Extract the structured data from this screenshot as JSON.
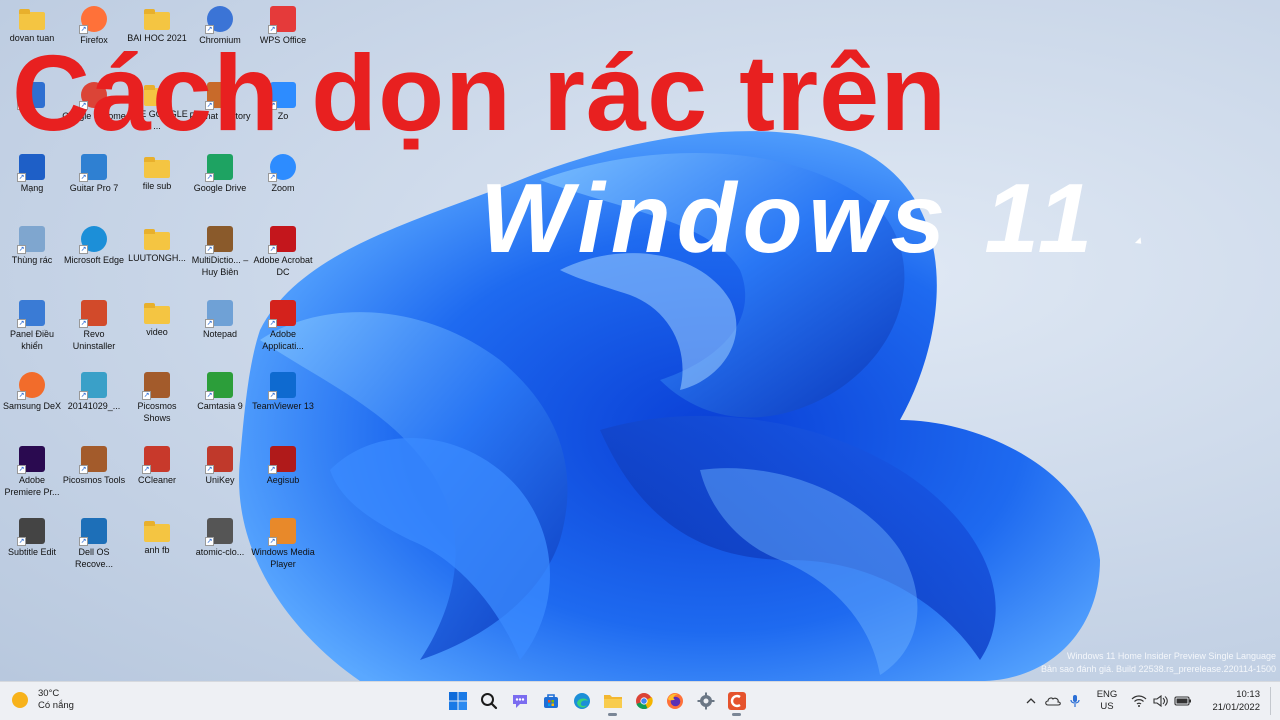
{
  "desktop": {
    "icons": [
      {
        "label": "dovan tuan",
        "icon": "folder-icon"
      },
      {
        "label": "Firefox",
        "icon": "firefox-icon"
      },
      {
        "label": "BAI HOC 2021",
        "icon": "folder-icon"
      },
      {
        "label": "Chromium",
        "icon": "chromium-icon"
      },
      {
        "label": "WPS Office",
        "icon": "wps-office-icon"
      },
      {
        "label": "PC",
        "icon": "pc-icon"
      },
      {
        "label": "Google Chrome",
        "icon": "chrome-icon"
      },
      {
        "label": "A SE GOOGLE ...",
        "icon": "folder-icon"
      },
      {
        "label": "Format Factory",
        "icon": "format-factory-icon"
      },
      {
        "label": "Zo",
        "icon": "zoom-app-icon"
      },
      {
        "label": "Mạng",
        "icon": "network-icon"
      },
      {
        "label": "Guitar Pro 7",
        "icon": "guitar-pro-icon"
      },
      {
        "label": "file sub",
        "icon": "folder-icon"
      },
      {
        "label": "Google Drive",
        "icon": "google-drive-icon"
      },
      {
        "label": "Zoom",
        "icon": "zoom-icon"
      },
      {
        "label": "Thùng rác",
        "icon": "recycle-bin-icon"
      },
      {
        "label": "Microsoft Edge",
        "icon": "edge-icon"
      },
      {
        "label": "LUUTONGH...",
        "icon": "folder-icon"
      },
      {
        "label": "MultiDictio... – Huy Biên",
        "icon": "multidictionary-icon"
      },
      {
        "label": "Adobe Acrobat DC",
        "icon": "acrobat-icon"
      },
      {
        "label": "Panel Điều khiển",
        "icon": "control-panel-icon"
      },
      {
        "label": "Revo Uninstaller",
        "icon": "revo-uninstaller-icon"
      },
      {
        "label": "video",
        "icon": "folder-icon"
      },
      {
        "label": "Notepad",
        "icon": "notepad-icon"
      },
      {
        "label": "Adobe Applicati...",
        "icon": "adobe-app-icon"
      },
      {
        "label": "Samsung DeX",
        "icon": "samsung-dex-icon"
      },
      {
        "label": "20141029_...",
        "icon": "photo-icon"
      },
      {
        "label": "Picosmos Shows",
        "icon": "picosmos-shows-icon"
      },
      {
        "label": "Camtasia 9",
        "icon": "camtasia-icon"
      },
      {
        "label": "TeamViewer 13",
        "icon": "teamviewer-icon"
      },
      {
        "label": "Adobe Premiere Pr...",
        "icon": "premiere-icon"
      },
      {
        "label": "Picosmos Tools",
        "icon": "picosmos-tools-icon"
      },
      {
        "label": "CCleaner",
        "icon": "ccleaner-icon"
      },
      {
        "label": "UniKey",
        "icon": "unikey-icon"
      },
      {
        "label": "Aegisub",
        "icon": "aegisub-icon"
      },
      {
        "label": "Subtitle Edit",
        "icon": "subtitle-edit-icon"
      },
      {
        "label": "Dell OS Recove...",
        "icon": "dell-recovery-icon"
      },
      {
        "label": "anh fb",
        "icon": "folder-icon"
      },
      {
        "label": "atomic-clo...",
        "icon": "atomic-clock-icon"
      },
      {
        "label": "Windows Media Player",
        "icon": "media-player-icon"
      }
    ]
  },
  "overlay": {
    "headline1": "Cách dọn rác trên",
    "headline2": "Windows 11",
    "headline1_color": "#e82020"
  },
  "watermark": {
    "line1": "Windows 11 Home Insider Preview Single Language",
    "line2": "Bản sao đánh giá. Build 22538.rs_prerelease.220114-1500"
  },
  "taskbar": {
    "weather_temp": "30°C",
    "weather_desc": "Có nắng",
    "apps": [
      {
        "name": "start-button",
        "icon": "windows-logo-icon"
      },
      {
        "name": "search-button",
        "icon": "search-icon"
      },
      {
        "name": "chat-button",
        "icon": "chat-icon"
      },
      {
        "name": "store-button",
        "icon": "store-icon"
      },
      {
        "name": "edge-button",
        "icon": "edge-icon"
      },
      {
        "name": "file-explorer-button",
        "icon": "folder-icon"
      },
      {
        "name": "chrome-button",
        "icon": "chrome-icon"
      },
      {
        "name": "firefox-button",
        "icon": "firefox-icon"
      },
      {
        "name": "settings-button",
        "icon": "gear-icon"
      },
      {
        "name": "ccleaner-button",
        "icon": "ccleaner-icon"
      }
    ],
    "lang_line1": "ENG",
    "lang_line2": "US",
    "time": "10:13",
    "date": "21/01/2022"
  }
}
